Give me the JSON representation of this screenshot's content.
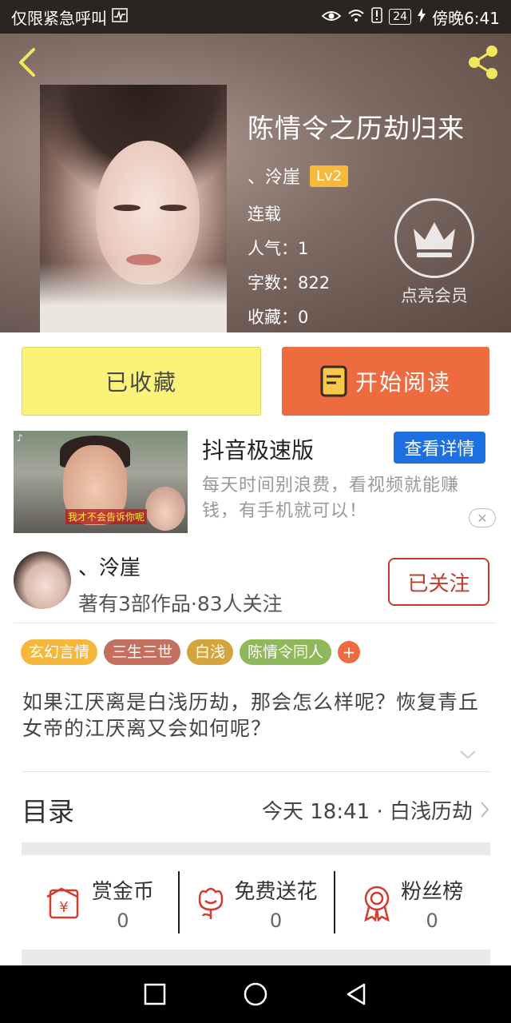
{
  "status_bar": {
    "carrier_text": "仅限紧急呼叫",
    "battery": "24",
    "time": "傍晚6:41"
  },
  "book": {
    "title": "陈情令之历劫归来",
    "author": "、泠崖",
    "level": "Lv2",
    "status": "连载",
    "popularity": "人气：1",
    "word_count": "字数：822",
    "favorites": "收藏：0"
  },
  "member": {
    "label": "点亮会员"
  },
  "actions": {
    "collected_label": "已收藏",
    "read_label": "开始阅读"
  },
  "ad": {
    "title": "抖音极速版",
    "detail_label": "查看详情",
    "description": "每天时间别浪费，看视频就能赚钱，有手机就可以！",
    "image_caption": "我才不会告诉你呢",
    "image_brand": "♪",
    "close_glyph": "✕"
  },
  "author_card": {
    "name": "、泠崖",
    "stats": "著有3部作品·83人关注",
    "follow_label": "已关注"
  },
  "tags": [
    {
      "label": "玄幻言情",
      "color": "#f5b83d"
    },
    {
      "label": "三生三世",
      "color": "#c5705e"
    },
    {
      "label": "白浅",
      "color": "#d4a53c"
    },
    {
      "label": "陈情令同人",
      "color": "#8fb85a"
    }
  ],
  "tag_add": "+",
  "synopsis": "如果江厌离是白浅历劫，那会怎么样呢？恢复青丘女帝的江厌离又会如何呢？",
  "catalog": {
    "title": "目录",
    "latest": "今天 18:41 · 白浅历劫"
  },
  "stats": [
    {
      "label": "赏金币",
      "value": "0",
      "icon": "reward-coin-icon"
    },
    {
      "label": "免费送花",
      "value": "0",
      "icon": "flower-icon"
    },
    {
      "label": "粉丝榜",
      "value": "0",
      "icon": "fan-ranking-icon"
    }
  ],
  "colors": {
    "accent_orange": "#ee6a3f",
    "collected_yellow": "#fbf27a",
    "follow_red": "#c53b2b",
    "ad_blue": "#1e6fe0"
  }
}
